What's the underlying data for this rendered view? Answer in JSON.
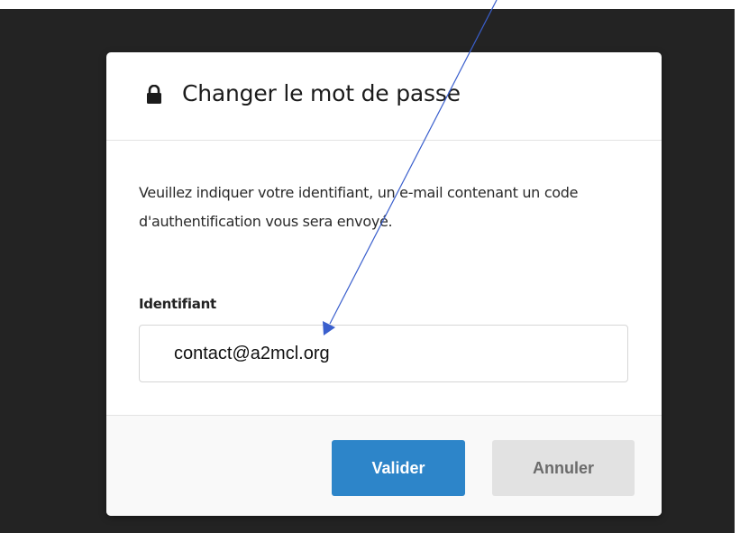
{
  "modal": {
    "title": "Changer le mot de passe",
    "icon": "lock-icon",
    "description": "Veuillez indiquer votre identifiant, un e-mail contenant un code d'authentification vous sera envoyé.",
    "field_label": "Identifiant",
    "field_value": "contact@a2mcl.org",
    "submit_label": "Valider",
    "cancel_label": "Annuler"
  },
  "colors": {
    "overlay": "#232323",
    "primary_button": "#2d85c9",
    "secondary_button": "#e2e2e2",
    "annotation_arrow": "#3a5fcd"
  }
}
